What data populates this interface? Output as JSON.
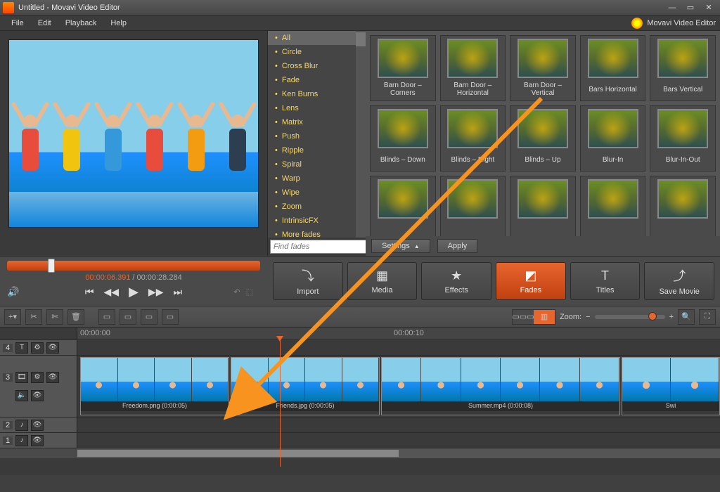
{
  "titlebar": {
    "title": "Untitled - Movavi Video Editor"
  },
  "menu": {
    "file": "File",
    "edit": "Edit",
    "playback": "Playback",
    "help": "Help",
    "brand": "Movavi Video Editor"
  },
  "categories": {
    "items": [
      "All",
      "Circle",
      "Cross Blur",
      "Fade",
      "Ken Burns",
      "Lens",
      "Matrix",
      "Push",
      "Ripple",
      "Spiral",
      "Warp",
      "Wipe",
      "Zoom",
      "IntrinsicFX",
      "More fades"
    ],
    "find_placeholder": "Find fades"
  },
  "transitions": {
    "row1": [
      "Barn Door – Corners",
      "Barn Door – Horizontal",
      "Barn Door – Vertical",
      "Bars Horizontal",
      "Bars Vertical"
    ],
    "row2": [
      "Blinds – Down",
      "Blinds – Right",
      "Blinds – Up",
      "Blur-In",
      "Blur-In-Out"
    ],
    "settings": "Settings",
    "apply": "Apply"
  },
  "playback": {
    "current": "00:00:06.391",
    "total": "00:00:28.284"
  },
  "modes": {
    "import": "Import",
    "media": "Media",
    "effects": "Effects",
    "fades": "Fades",
    "titles": "Titles",
    "save": "Save Movie"
  },
  "toolbar": {
    "zoom": "Zoom:"
  },
  "ruler": {
    "t0": "00:00:00",
    "t1": "00:00:10"
  },
  "clips": {
    "c1": {
      "label": "Freedom.png (0:00:05)"
    },
    "c2": {
      "label": "Friends.jpg (0:00:05)"
    },
    "c3": {
      "label": "Summer.mp4 (0:00:08)"
    },
    "c4": {
      "label": "Swi"
    }
  },
  "tracks": {
    "n4": "4",
    "n3": "3",
    "n2": "2",
    "n1": "1"
  }
}
